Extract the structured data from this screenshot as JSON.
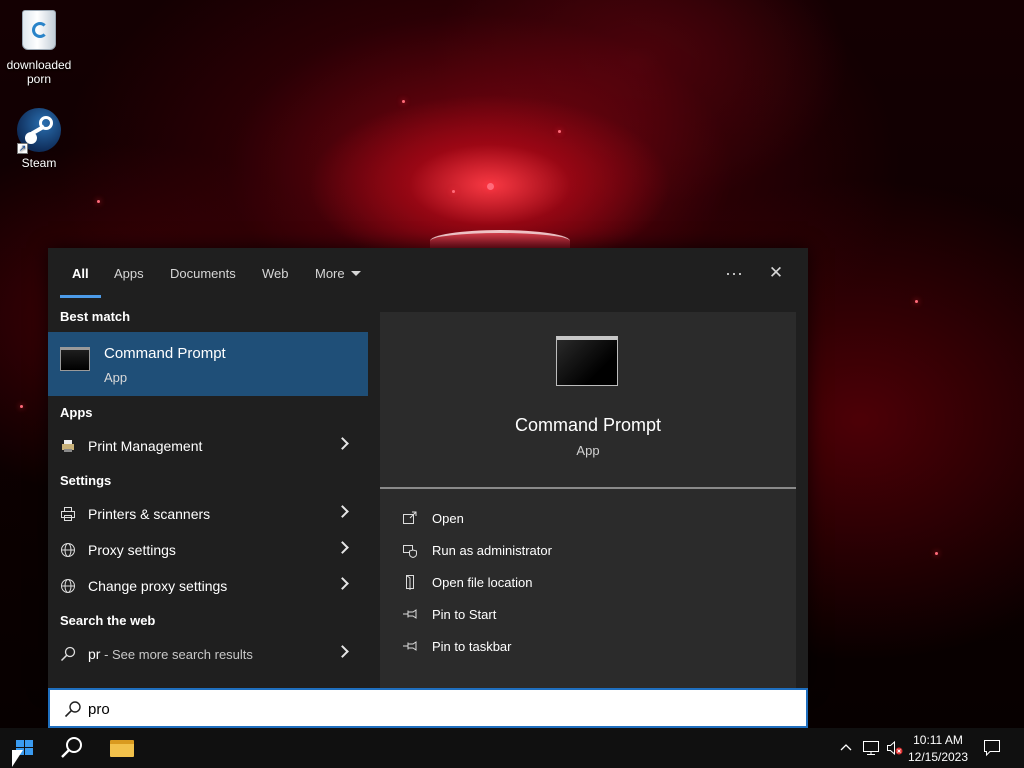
{
  "desktop": {
    "icons": [
      {
        "label": "downloaded porn",
        "icon": "recycle-bin-icon"
      },
      {
        "label": "Steam",
        "icon": "steam-icon"
      }
    ]
  },
  "search_flyout": {
    "tabs": [
      {
        "label": "All",
        "active": true
      },
      {
        "label": "Apps"
      },
      {
        "label": "Documents"
      },
      {
        "label": "Web"
      },
      {
        "label": "More"
      }
    ],
    "more_options_glyph": "···",
    "close_glyph": "✕",
    "best_match": {
      "heading": "Best match",
      "title": "Command Prompt",
      "subtitle": "App"
    },
    "apps": {
      "heading": "Apps",
      "items": [
        {
          "label": "Print Management",
          "icon": "print-management-icon"
        }
      ]
    },
    "settings": {
      "heading": "Settings",
      "items": [
        {
          "label": "Printers & scanners",
          "icon": "printer-icon"
        },
        {
          "label": "Proxy settings",
          "icon": "globe-icon"
        },
        {
          "label": "Change proxy settings",
          "icon": "globe-icon"
        }
      ]
    },
    "web": {
      "heading": "Search the web",
      "query": "pr",
      "hint": " - See more search results"
    },
    "preview": {
      "title": "Command Prompt",
      "subtitle": "App",
      "actions": [
        {
          "label": "Open",
          "icon": "open-icon"
        },
        {
          "label": "Run as administrator",
          "icon": "shield-icon"
        },
        {
          "label": "Open file location",
          "icon": "file-location-icon"
        },
        {
          "label": "Pin to Start",
          "icon": "pin-icon"
        },
        {
          "label": "Pin to taskbar",
          "icon": "pin-icon"
        }
      ]
    },
    "accent": "#1f4f78",
    "highlight": "#4c9be8"
  },
  "search_box": {
    "value": "pro"
  },
  "taskbar": {
    "time": "10:11 AM",
    "date": "12/15/2023"
  }
}
